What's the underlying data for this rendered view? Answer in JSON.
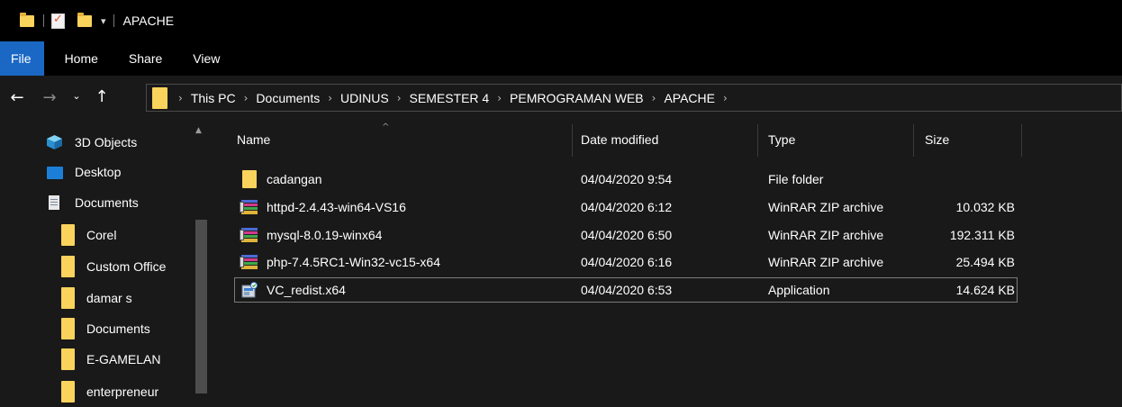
{
  "window": {
    "title": "APACHE"
  },
  "ribbon": {
    "tabs": [
      "File",
      "Home",
      "Share",
      "View"
    ]
  },
  "address": {
    "breadcrumbs": [
      "This PC",
      "Documents",
      "UDINUS",
      "SEMESTER 4",
      "PEMROGRAMAN WEB",
      "APACHE"
    ]
  },
  "nav_pane": {
    "items": [
      {
        "label": "3D Objects",
        "icon": "3d-objects-icon"
      },
      {
        "label": "Desktop",
        "icon": "desktop-icon"
      },
      {
        "label": "Documents",
        "icon": "documents-icon"
      },
      {
        "label": "Corel",
        "icon": "folder-icon"
      },
      {
        "label": "Custom Office",
        "icon": "folder-icon"
      },
      {
        "label": "damar s",
        "icon": "folder-icon"
      },
      {
        "label": "Documents",
        "icon": "folder-icon"
      },
      {
        "label": "E-GAMELAN",
        "icon": "folder-icon"
      },
      {
        "label": "enterpreneur",
        "icon": "folder-icon"
      }
    ]
  },
  "columns": {
    "name": "Name",
    "date": "Date modified",
    "type": "Type",
    "size": "Size"
  },
  "files": [
    {
      "name": "cadangan",
      "date": "04/04/2020 9:54",
      "type": "File folder",
      "size": "",
      "icon": "folder-icon"
    },
    {
      "name": "httpd-2.4.43-win64-VS16",
      "date": "04/04/2020 6:12",
      "type": "WinRAR ZIP archive",
      "size": "10.032 KB",
      "icon": "winrar-archive-icon"
    },
    {
      "name": "mysql-8.0.19-winx64",
      "date": "04/04/2020 6:50",
      "type": "WinRAR ZIP archive",
      "size": "192.311 KB",
      "icon": "winrar-archive-icon"
    },
    {
      "name": "php-7.4.5RC1-Win32-vc15-x64",
      "date": "04/04/2020 6:16",
      "type": "WinRAR ZIP archive",
      "size": "25.494 KB",
      "icon": "winrar-archive-icon"
    },
    {
      "name": "VC_redist.x64",
      "date": "04/04/2020 6:53",
      "type": "Application",
      "size": "14.624 KB",
      "icon": "installer-app-icon",
      "selected": true
    }
  ],
  "colors": {
    "background": "#191919",
    "chrome": "#000000",
    "file_tab": "#1a68c4",
    "folder": "#f9d35b"
  }
}
